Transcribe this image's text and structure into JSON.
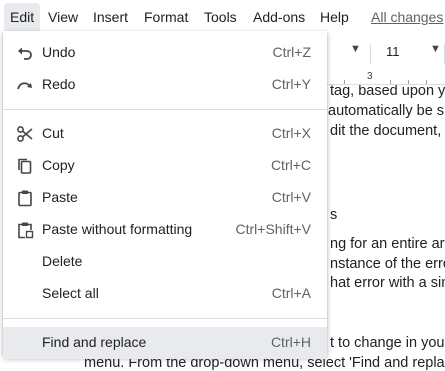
{
  "menubar": {
    "items": [
      "Edit",
      "View",
      "Insert",
      "Format",
      "Tools",
      "Add-ons",
      "Help"
    ],
    "status_link": "All changes"
  },
  "toolbar": {
    "font_size": "11",
    "ruler_number": "3"
  },
  "document": {
    "lines": [
      "tag, based upon y",
      "automatically be s",
      "dit the document, th",
      "s",
      "ng for an entire artic",
      "nstance of the erro",
      "hat error with a sin",
      "t to change in you",
      "menu. From the drop-down menu, select 'Find and repla"
    ]
  },
  "edit_menu": {
    "items": [
      {
        "label": "Undo",
        "shortcut": "Ctrl+Z",
        "icon": "undo-icon"
      },
      {
        "label": "Redo",
        "shortcut": "Ctrl+Y",
        "icon": "redo-icon"
      },
      {
        "label": "Cut",
        "shortcut": "Ctrl+X",
        "icon": "scissors-icon"
      },
      {
        "label": "Copy",
        "shortcut": "Ctrl+C",
        "icon": "copy-icon"
      },
      {
        "label": "Paste",
        "shortcut": "Ctrl+V",
        "icon": "paste-icon"
      },
      {
        "label": "Paste without formatting",
        "shortcut": "Ctrl+Shift+V",
        "icon": "paste-plain-icon"
      },
      {
        "label": "Delete",
        "shortcut": ""
      },
      {
        "label": "Select all",
        "shortcut": "Ctrl+A"
      },
      {
        "label": "Find and replace",
        "shortcut": "Ctrl+H"
      }
    ]
  },
  "colors": {
    "menu_highlight": "#e8eaed",
    "text": "#202124",
    "shortcut": "#5f6368",
    "divider": "#dadce0"
  }
}
